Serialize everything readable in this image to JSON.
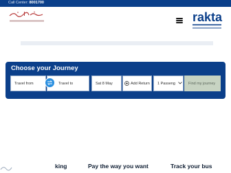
{
  "topbar": {
    "call_label": "Call Center:",
    "call_number": "8001700"
  },
  "logos": {
    "government": "government-of-ras-al-khaimah-logo",
    "rakta_word": "rakta",
    "rakta_ar": "هيئة رأس الخيمة للمواصلات",
    "rakta_en": "RAS AL KHAIMAH TRANSPORT AUTHORITY"
  },
  "journey": {
    "heading": "Choose your Journey",
    "from_placeholder": "Travel from",
    "to_placeholder": "Travel to",
    "date": "Sat 8 May",
    "return_label": "Add Return",
    "passengers": "1 Passeng",
    "find_button": "Find my journey"
  },
  "features": {
    "f1": "king",
    "f2": "Pay the way you want",
    "f3": "Track your bus"
  },
  "colors": {
    "brand_blue": "#0b3f8a",
    "swap_blue": "#2a8fe0",
    "button_disabled": "#c7d3c2",
    "gov_red": "#b83a3a"
  },
  "icons": [
    "hamburger-menu-icon",
    "swap-arrows-icon",
    "plus-circle-icon",
    "chevron-down-icon",
    "wave-icon"
  ]
}
